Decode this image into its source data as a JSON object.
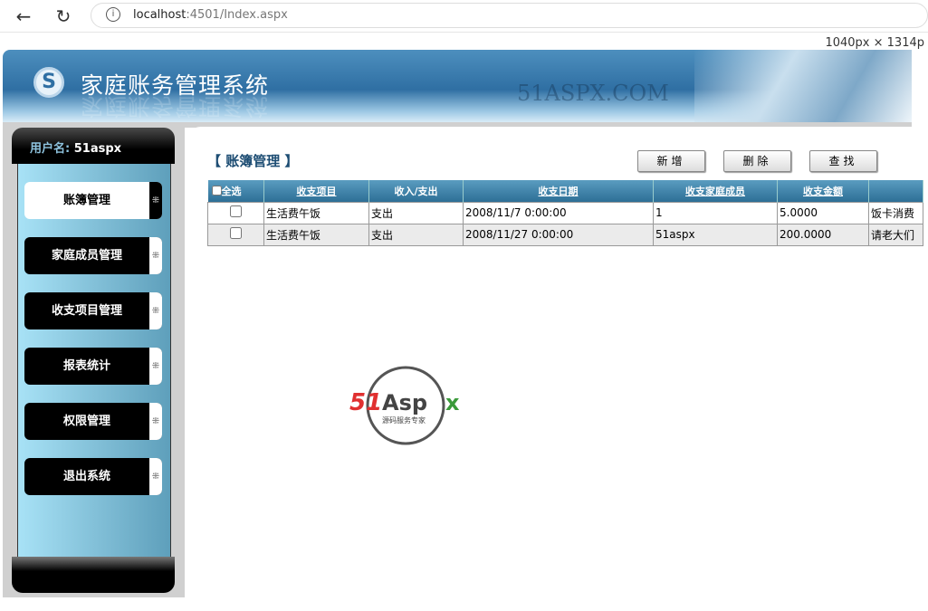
{
  "browser": {
    "back": "←",
    "reload": "↻",
    "info": "i",
    "url_host": "localhost",
    "url_path": ":4501/Index.aspx",
    "dimensions": "1040px × 1314p"
  },
  "header": {
    "title": "家庭账务管理系统",
    "watermark": "51ASPX.COM"
  },
  "sidebar": {
    "user_label": "用户名:",
    "username": "51aspx",
    "items": [
      {
        "label": "账簿管理",
        "active": true
      },
      {
        "label": "家庭成员管理"
      },
      {
        "label": "收支项目管理"
      },
      {
        "label": "报表统计"
      },
      {
        "label": "权限管理"
      },
      {
        "label": "退出系统"
      }
    ]
  },
  "main": {
    "section_title": "【 账簿管理 】",
    "buttons": {
      "add": "新增",
      "delete": "删除",
      "search": "查找"
    },
    "table": {
      "select_all": "全选",
      "columns": [
        "收支项目",
        "收入/支出",
        "收支日期",
        "收支家庭成员",
        "收支金额",
        ""
      ],
      "rows": [
        [
          "生活费午饭",
          "支出",
          "2008/11/7 0:00:00",
          "1",
          "5.0000",
          "饭卡消费"
        ],
        [
          "生活费午饭",
          "支出",
          "2008/11/27 0:00:00",
          "51aspx",
          "200.0000",
          "请老大们"
        ]
      ]
    }
  },
  "watermark_logo": {
    "brand": "51Aspx",
    "tagline": "源码服务专家"
  }
}
